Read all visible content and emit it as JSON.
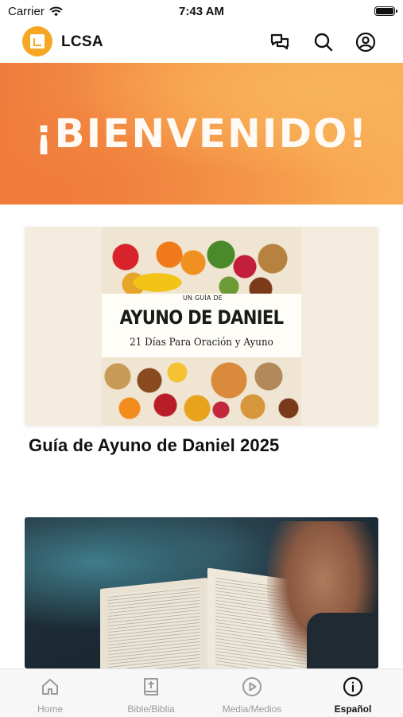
{
  "status_bar": {
    "carrier": "Carrier",
    "time": "7:43 AM",
    "battery_level": 0.9
  },
  "app": {
    "name": "LCSA"
  },
  "header_icons": [
    "chat-icon",
    "search-icon",
    "profile-icon"
  ],
  "banner": {
    "text": "¡BIENVENIDO!"
  },
  "feed": [
    {
      "image_kicker": "UN GUÍA DE",
      "image_title": "AYUNO DE DANIEL",
      "image_subtitle": "21 Días Para Oración y Ayuno",
      "title": "Guía de Ayuno de Daniel 2025"
    },
    {
      "image": "open-bible-photo"
    }
  ],
  "tabs": [
    {
      "label": "Home",
      "icon": "home-icon",
      "active": false
    },
    {
      "label": "Bible/Biblia",
      "icon": "bible-icon",
      "active": false
    },
    {
      "label": "Media/Medios",
      "icon": "play-icon",
      "active": false
    },
    {
      "label": "Español",
      "icon": "info-icon",
      "active": true
    }
  ],
  "colors": {
    "accent": "#f5a623",
    "banner_start": "#ef7b3c",
    "banner_end": "#f8ad55"
  }
}
